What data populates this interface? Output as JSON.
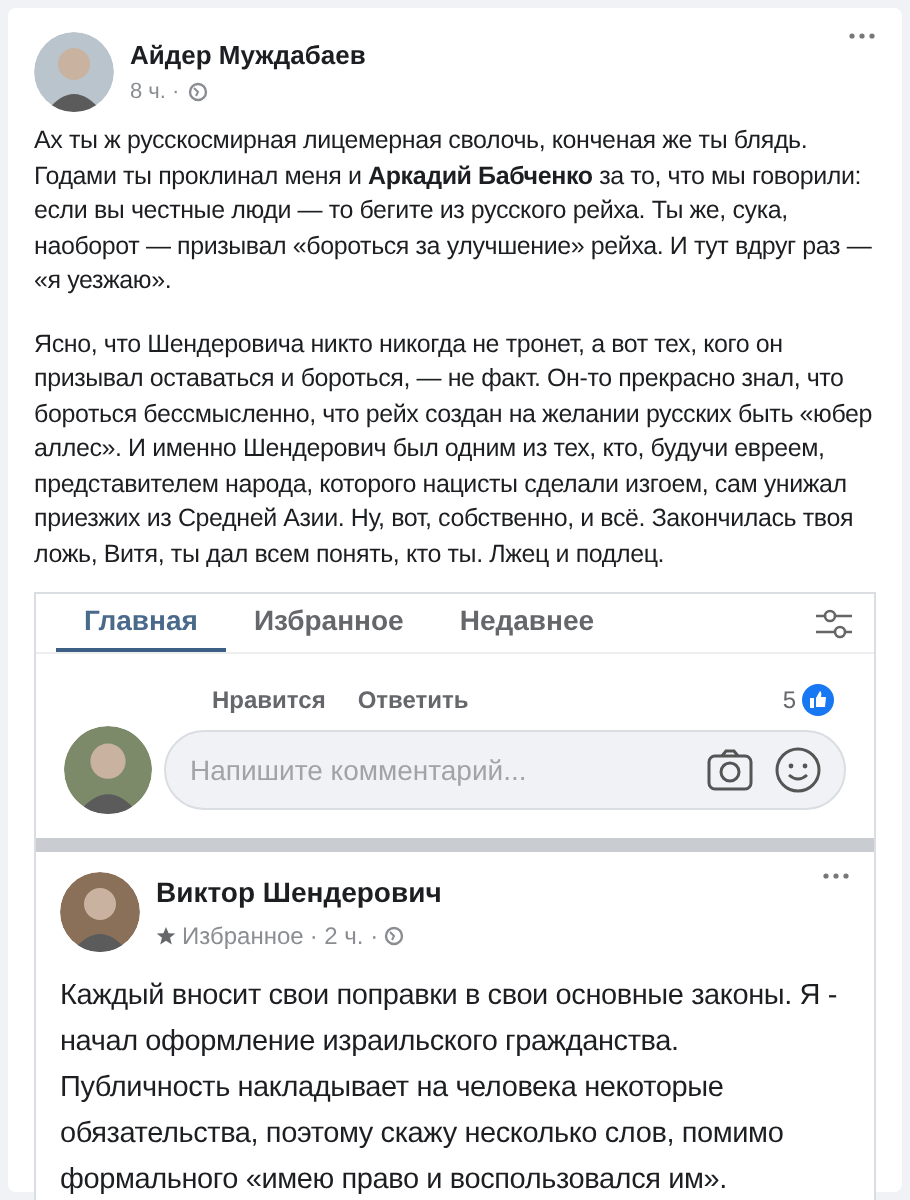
{
  "post": {
    "author": "Айдер Муждабаев",
    "meta": "8 ч. ·",
    "paragraphs": [
      "Ах ты ж русскосмирная лицемерная сволочь, конченая же ты блядь. Годами ты проклинал меня и **Аркадий Бабченко** за то, что мы говорили: если вы честные люди — то бегите из русского рейха. Ты же, сука, наоборот — призывал «бороться за улучшение» рейха. И тут вдруг раз — «я уезжаю».",
      "Ясно, что Шендеровича никто никогда не тронет, а вот тех, кого он призывал оставаться и бороться, — не факт. Он-то прекрасно знал, что бороться бессмысленно, что рейх создан на желании русских быть «юбер аллес». И именно Шендерович был одним из тех, кто, будучи евреем, представителем народа, которого нацисты сделали изгоем, сам унижал приезжих из Средней Азии. Ну, вот, собственно, и всё. Закончилась твоя ложь, Витя, ты дал всем понять, кто ты. Лжец и подлец."
    ]
  },
  "embedded": {
    "tabs": [
      {
        "label": "Главная",
        "selected": true
      },
      {
        "label": "Избранное",
        "selected": false
      },
      {
        "label": "Недавнее",
        "selected": false
      }
    ],
    "comment_actions": [
      "Нравится",
      "Ответить"
    ],
    "like_count": "5",
    "comment_field": {
      "placeholder": "Напишите комментарий..."
    },
    "post": {
      "author": "Виктор Шендерович",
      "audience": "Избранное",
      "meta": "· 2 ч. ·",
      "text": "Каждый вносит свои поправки в свои основные законы.  Я - начал оформление израильского гражданства.  Публичность накладывает на человека некоторые обязательства, поэтому скажу несколько слов, помимо формального «имею право и воспользовался им»."
    }
  }
}
